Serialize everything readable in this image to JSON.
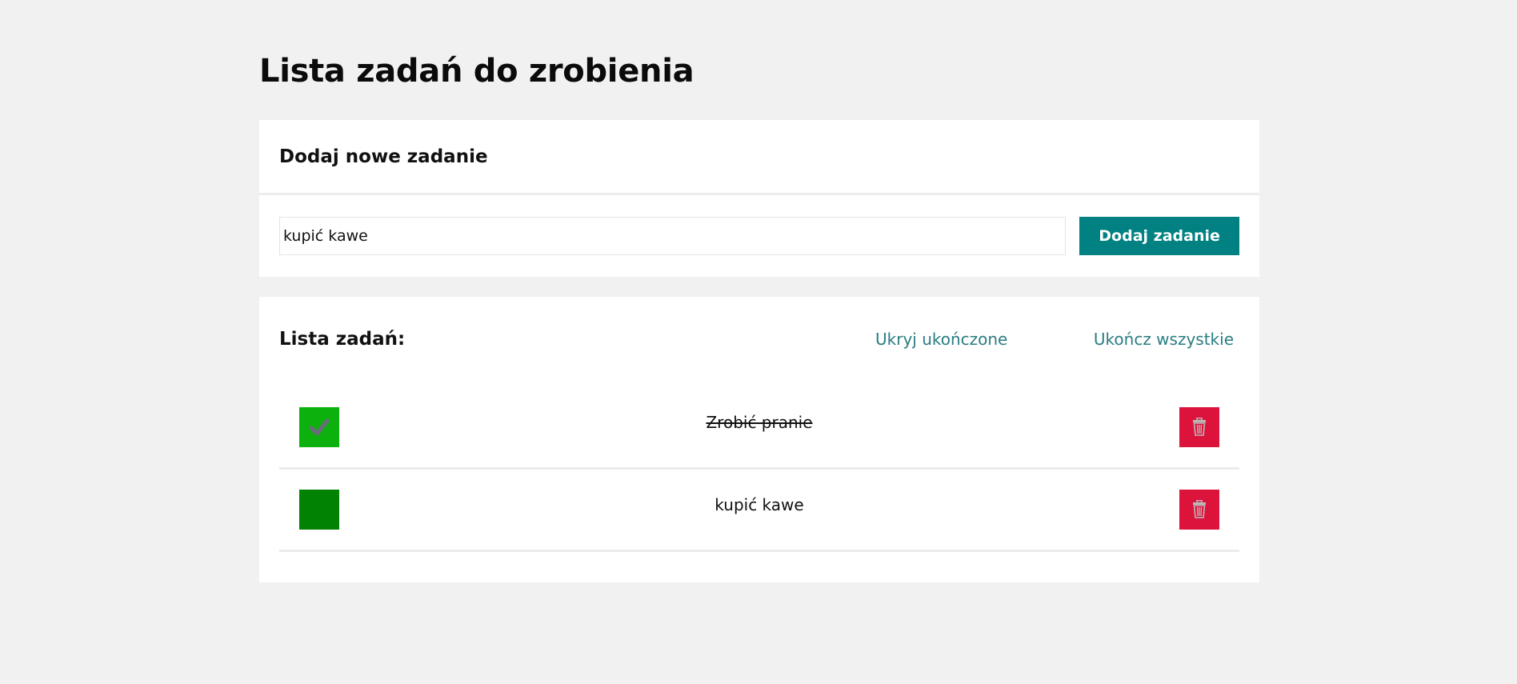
{
  "page": {
    "title": "Lista zadań do zrobienia"
  },
  "add_task": {
    "heading": "Dodaj nowe zadanie",
    "input_value": "kupić kawe",
    "button_label": "Dodaj zadanie"
  },
  "task_list": {
    "heading": "Lista zadań:",
    "hide_completed_label": "Ukryj ukończone",
    "complete_all_label": "Ukończ wszystkie",
    "tasks": [
      {
        "text": "Zrobić pranie",
        "completed": true
      },
      {
        "text": "kupić kawe",
        "completed": false
      }
    ]
  },
  "icons": {
    "check": "check-icon",
    "delete": "trash-icon"
  },
  "colors": {
    "accent": "#018181",
    "link": "#2a7d82",
    "done_checkbox": "#0db10d",
    "todo_checkbox": "#028202",
    "delete": "#dc143c"
  }
}
